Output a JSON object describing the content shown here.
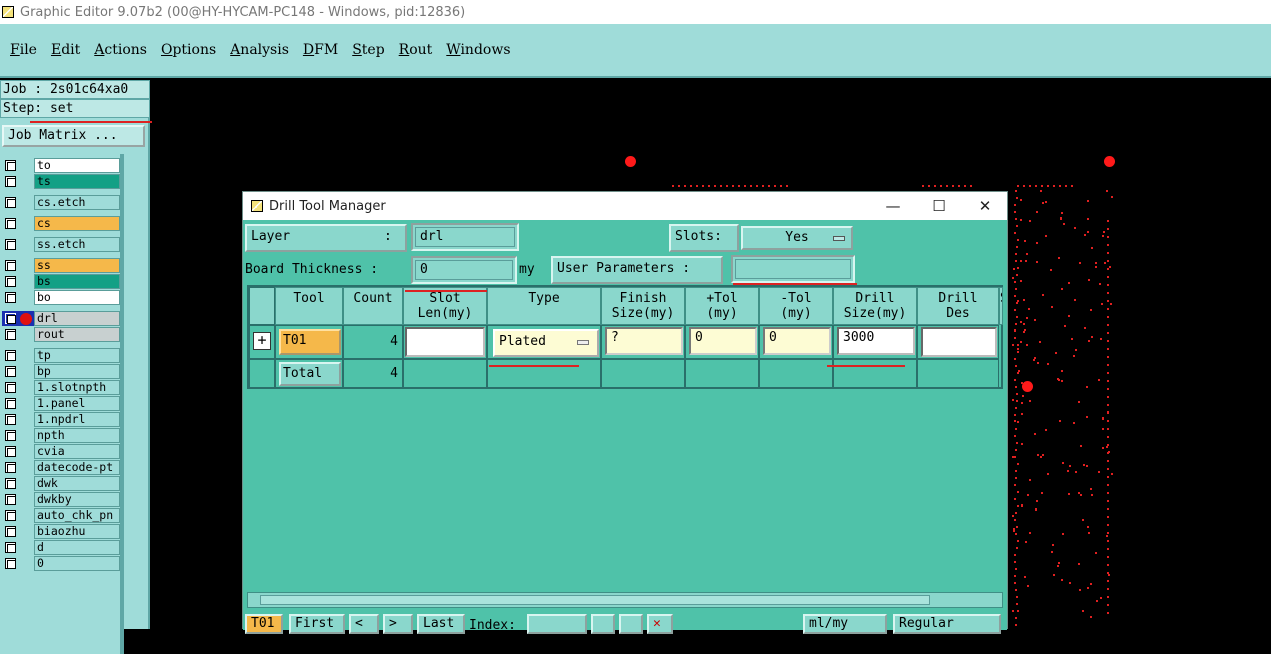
{
  "window": {
    "title": "Graphic Editor 9.07b2 (00@HY-HYCAM-PC148 - Windows, pid:12836)"
  },
  "menu": [
    "File",
    "Edit",
    "Actions",
    "Options",
    "Analysis",
    "DFM",
    "Step",
    "Rout",
    "Windows"
  ],
  "job": {
    "job_line": "Job : 2s01c64xa0",
    "step_line": "Step: set",
    "matrix_button": "Job Matrix ..."
  },
  "layers": [
    {
      "name": "to",
      "color": "#ffffff"
    },
    {
      "name": "ts",
      "color": "#13a085"
    },
    {
      "name": "cs.etch",
      "color": "#9fdcd9"
    },
    {
      "name": "cs",
      "color": "#f5b84a"
    },
    {
      "name": "ss.etch",
      "color": "#9fdcd9"
    },
    {
      "name": "ss",
      "color": "#f5b84a"
    },
    {
      "name": "bs",
      "color": "#13a085"
    },
    {
      "name": "bo",
      "color": "#ffffff"
    },
    {
      "name": "drl",
      "color": "#c8d0d0",
      "active": true
    },
    {
      "name": "rout",
      "color": "#c8d0d0"
    },
    {
      "name": "tp",
      "color": "#9fdcd9"
    },
    {
      "name": "bp",
      "color": "#9fdcd9"
    },
    {
      "name": "1.slotnpth",
      "color": "#9fdcd9"
    },
    {
      "name": "1.panel",
      "color": "#9fdcd9"
    },
    {
      "name": "1.npdrl",
      "color": "#9fdcd9"
    },
    {
      "name": "npth",
      "color": "#9fdcd9"
    },
    {
      "name": "cvia",
      "color": "#9fdcd9"
    },
    {
      "name": "datecode-pt",
      "color": "#9fdcd9"
    },
    {
      "name": "dwk",
      "color": "#9fdcd9"
    },
    {
      "name": "dwkby",
      "color": "#9fdcd9"
    },
    {
      "name": "auto_chk_pn",
      "color": "#9fdcd9"
    },
    {
      "name": "biaozhu",
      "color": "#9fdcd9"
    },
    {
      "name": "d",
      "color": "#9fdcd9"
    },
    {
      "name": "0",
      "color": "#9fdcd9"
    }
  ],
  "dialog": {
    "title": "Drill Tool Manager",
    "minimize": "—",
    "maximize": "☐",
    "close": "✕",
    "layer_label": "Layer            :",
    "layer_value": "drl",
    "slots_label": "Slots:",
    "slots_value": "Yes",
    "board_thickness_label": "Board Thickness :",
    "board_thickness_value": "0",
    "board_thickness_unit": "my",
    "user_params_label": "User Parameters :",
    "user_params_value": "",
    "headers": [
      {
        "l1": "Tool",
        "l2": ""
      },
      {
        "l1": "Count",
        "l2": ""
      },
      {
        "l1": "Slot",
        "l2": "Len(my)"
      },
      {
        "l1": "Type",
        "l2": ""
      },
      {
        "l1": "Finish",
        "l2": "Size(my)"
      },
      {
        "l1": "+Tol",
        "l2": "(my)"
      },
      {
        "l1": "-Tol",
        "l2": "(my)"
      },
      {
        "l1": "Drill",
        "l2": "Size(my)"
      },
      {
        "l1": "Drill",
        "l2": "Des"
      },
      {
        "l1": "S",
        "l2": ""
      }
    ],
    "row": {
      "expand": "+",
      "tool": "T01",
      "count": "4",
      "slot_len": "",
      "type": "Plated",
      "finish": "?",
      "plus_tol": "0",
      "minus_tol": "0",
      "drill_size": "3000",
      "drill_des": ""
    },
    "total": {
      "label": "Total",
      "count": "4"
    },
    "bottom": {
      "tool": "T01",
      "first": "First",
      "prev": "<",
      "next": ">",
      "last": "Last",
      "index_label": "Index:",
      "index_value": "",
      "units": "ml/my",
      "mode": "Regular"
    }
  }
}
